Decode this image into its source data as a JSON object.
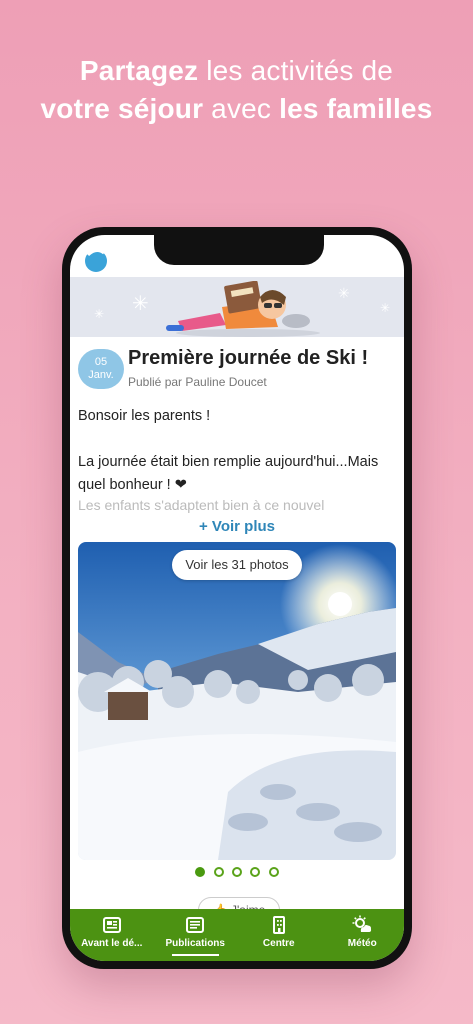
{
  "headline": {
    "line1_bold": "Partagez",
    "line1_rest": " les activités de",
    "line2_bold_a": "votre séjour",
    "line2_mid": " avec ",
    "line2_bold_b": "les familles"
  },
  "post": {
    "date_day": "05",
    "date_month": "Janv.",
    "title": "Première journée de Ski !",
    "author": "Publié par Pauline Doucet",
    "body": [
      "Bonsoir les parents !",
      "",
      "La journée était bien remplie aujourd'hui...Mais quel bonheur ! ❤"
    ],
    "faded_line": "Les enfants s'adaptent bien à ce nouvel",
    "see_more": "+ Voir plus",
    "photos_button": "Voir les 31 photos",
    "photo_count_dots": 5,
    "active_dot": 0,
    "like_label": "J'aime"
  },
  "tabs": [
    {
      "label": "Avant le dé...",
      "icon": "newspaper-icon"
    },
    {
      "label": "Publications",
      "icon": "publications-icon",
      "active": true
    },
    {
      "label": "Centre",
      "icon": "building-icon"
    },
    {
      "label": "Météo",
      "icon": "weather-icon"
    }
  ],
  "colors": {
    "background": "#f0a7bb",
    "accent_green": "#4c9212",
    "link_blue": "#2f86b8",
    "date_badge": "#8fc6e6"
  }
}
